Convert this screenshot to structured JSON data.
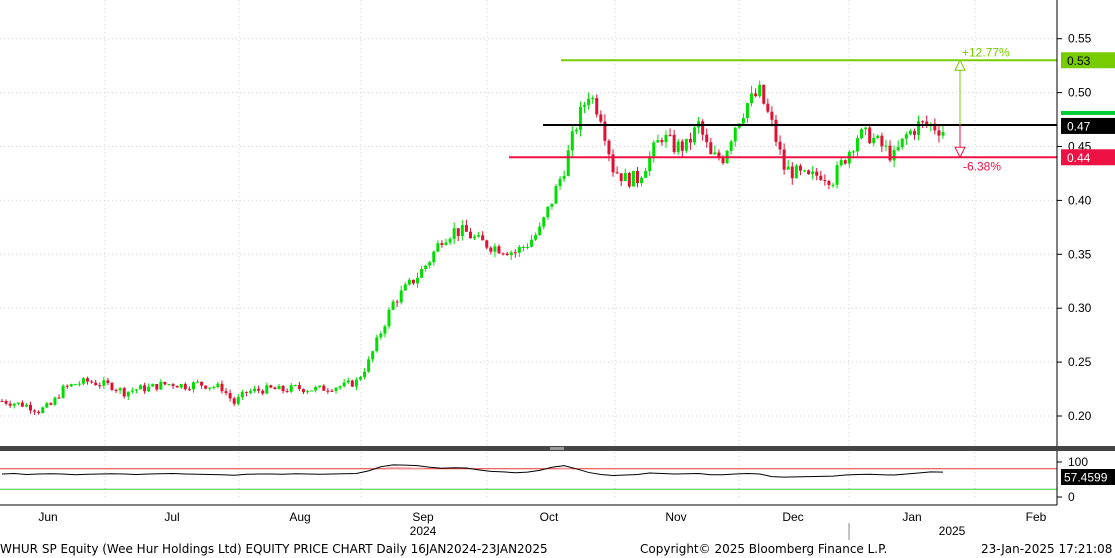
{
  "chart_data": [
    {
      "type": "candlestick",
      "ticker": "WHUR SP Equity",
      "frequency": "Daily",
      "ylim": [
        0.18,
        0.56
      ],
      "y_ticks": [
        "0.20",
        "0.25",
        "0.30",
        "0.35",
        "0.40",
        "0.45",
        "0.50",
        "0.55"
      ],
      "up_color": "#00dd00",
      "down_color": "#dd1133",
      "x_labels": [
        "Jun",
        "Jul",
        "Aug",
        "Sep",
        "Oct",
        "Nov",
        "Dec",
        "Jan",
        "Feb"
      ],
      "year_labels": [
        "2024",
        "2025"
      ],
      "weekly_closes": [
        0.214,
        0.212,
        0.21,
        0.205,
        0.21,
        0.225,
        0.23,
        0.232,
        0.23,
        0.228,
        0.222,
        0.225,
        0.226,
        0.229,
        0.23,
        0.228,
        0.23,
        0.228,
        0.226,
        0.212,
        0.222,
        0.224,
        0.225,
        0.224,
        0.226,
        0.225,
        0.225,
        0.227,
        0.228,
        0.232,
        0.25,
        0.278,
        0.305,
        0.318,
        0.33,
        0.345,
        0.365,
        0.372,
        0.37,
        0.362,
        0.358,
        0.355,
        0.352,
        0.36,
        0.372,
        0.4,
        0.43,
        0.47,
        0.5,
        0.48,
        0.43,
        0.42,
        0.42,
        0.44,
        0.46,
        0.45,
        0.45,
        0.47,
        0.44,
        0.44,
        0.47,
        0.49,
        0.5,
        0.47,
        0.43,
        0.425,
        0.42,
        0.425,
        0.42,
        0.44,
        0.46,
        0.46,
        0.45,
        0.44,
        0.46,
        0.47,
        0.47,
        0.465
      ],
      "lines": [
        {
          "name": "resistance",
          "value": 0.53,
          "color": "#77cc00",
          "label": "0.53"
        },
        {
          "name": "current",
          "value": 0.47,
          "color": "#000000",
          "label": "0.47"
        },
        {
          "name": "support",
          "value": 0.44,
          "color": "#ee1144",
          "label": "0.44"
        }
      ],
      "annotations": {
        "up_pct": "+12.77%",
        "down_pct": "-6.38%"
      }
    },
    {
      "type": "line",
      "indicator": "RSI",
      "ylim": [
        0,
        100
      ],
      "y_ticks": [
        "100",
        "0"
      ],
      "upper_line": 70,
      "lower_line": 30,
      "last_value": "57.4599",
      "values": [
        50,
        52,
        48,
        50,
        51,
        50,
        47,
        49,
        50,
        51,
        50,
        48,
        50,
        51,
        52,
        50,
        49,
        48,
        47,
        45,
        49,
        50,
        50,
        49,
        51,
        50,
        49,
        50,
        51,
        52,
        62,
        78,
        85,
        84,
        82,
        76,
        72,
        74,
        73,
        66,
        60,
        58,
        55,
        57,
        64,
        76,
        82,
        70,
        56,
        48,
        44,
        46,
        48,
        54,
        52,
        50,
        51,
        52,
        47,
        47,
        50,
        52,
        50,
        40,
        38,
        39,
        40,
        41,
        42,
        46,
        48,
        49,
        47,
        46,
        50,
        54,
        58,
        57
      ]
    }
  ],
  "footer": {
    "left": "WHUR SP Equity (Wee Hur Holdings Ltd) EQUITY PRICE CHART  Daily 16JAN2024-23JAN2025",
    "center": "Copyright© 2025 Bloomberg Finance L.P.",
    "right": "23-Jan-2025 17:21:08"
  }
}
